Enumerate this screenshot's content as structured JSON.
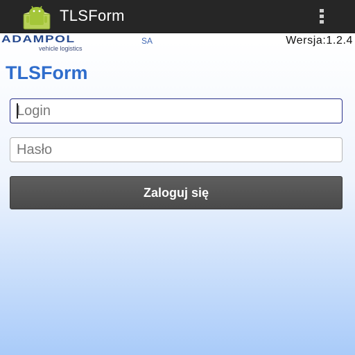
{
  "action_bar": {
    "title": "TLSForm",
    "app_icon": "android-robot-icon",
    "overflow_icon": "overflow-menu-icon"
  },
  "header": {
    "logo_name": "ADAMPOL",
    "logo_suffix": "SA",
    "logo_tagline": "vehicle logistics",
    "version": "Wersja:1.2.4"
  },
  "form": {
    "title": "TLSForm",
    "login_placeholder": "Login",
    "password_placeholder": "Hasło",
    "submit_label": "Zaloguj się"
  },
  "colors": {
    "action_bar_bg": "#262626",
    "title_blue": "#2f6dcc",
    "logo_blue": "#274a8f",
    "button_bg": "#4f4f4f",
    "focused_border": "#27308a",
    "gradient_bottom": "#a9cbf9"
  }
}
